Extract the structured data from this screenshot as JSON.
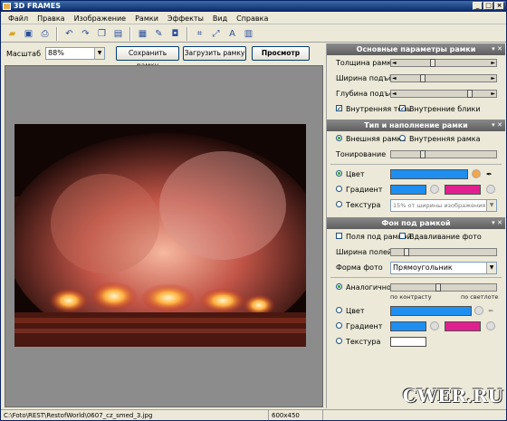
{
  "window": {
    "title": "3D FRAMES"
  },
  "menu": [
    "Файл",
    "Правка",
    "Изображение",
    "Рамки",
    "Эффекты",
    "Вид",
    "Справка"
  ],
  "zoom": {
    "label": "Масштаб",
    "value": "88%"
  },
  "buttons": {
    "save_frame": "Сохранить рамку",
    "load_frame": "Загрузить рамку",
    "preview": "Просмотр"
  },
  "status": {
    "path": "C:\\Foto\\REST\\RestofWorld\\0607_cz_smed_3.jpg",
    "size": "600x450"
  },
  "watermark": "CWER.RU",
  "panel1": {
    "title": "Основные параметры рамки",
    "thickness": "Толщина рамки",
    "thickness_level": 0.4,
    "rise_width": "Ширина подъёма",
    "rise_width_level": 0.3,
    "rise_depth": "Глубина подъёма",
    "rise_depth_level": 0.75,
    "inner_shadow": "Внутренняя тень",
    "inner_highlights": "Внутренние блики"
  },
  "panel2": {
    "title": "Тип и наполнение рамки",
    "outer_frame": "Внешняя рамка",
    "inner_frame": "Внутренняя рамка",
    "tint": "Тонирование",
    "tint_level": 0.3,
    "color": "Цвет",
    "gradient": "Градиент",
    "texture": "Текстура",
    "texture_value": "15% от ширины изображения",
    "colors": {
      "main": "#1e8ff0",
      "grad_a": "#1e8ff0",
      "grad_b": "#e0208f"
    }
  },
  "panel3": {
    "title": "Фон под рамкой",
    "fields_under_frame": "Поля под рамкой",
    "photo_inset": "Вдавливание фото",
    "field_width": "Ширина полей",
    "field_width_level": 0.15,
    "photo_shape": "Форма фото",
    "photo_shape_value": "Прямоугольник",
    "analog": "Аналогичное",
    "analog_level": 0.45,
    "by_contrast": "по контрасту",
    "by_brightness": "по светлоте",
    "color": "Цвет",
    "gradient": "Градиент",
    "texture": "Текстура",
    "colors": {
      "main": "#1e8ff0",
      "grad_a": "#1e8ff0",
      "grad_b": "#e0208f"
    }
  }
}
